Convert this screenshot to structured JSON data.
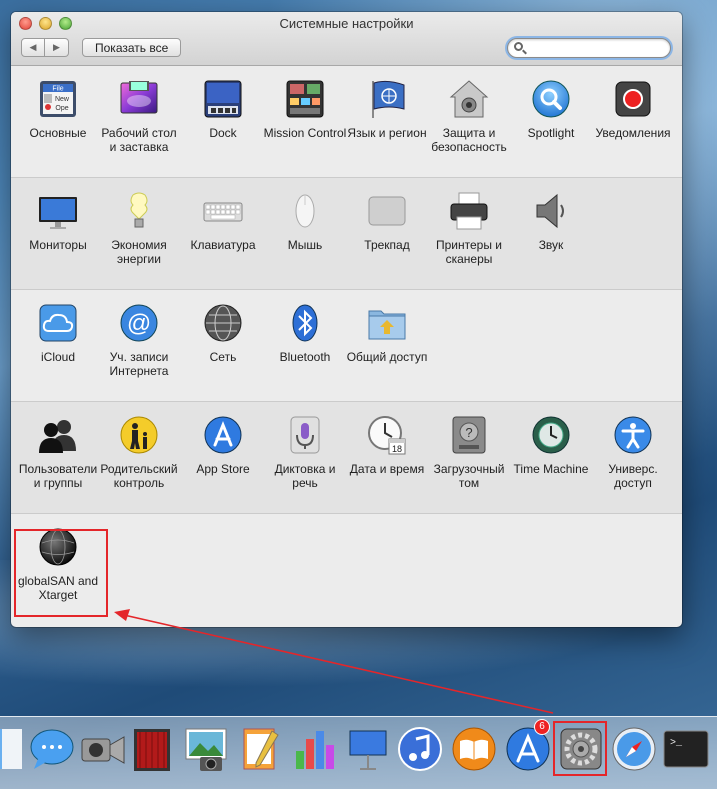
{
  "window": {
    "title": "Системные настройки",
    "show_all": "Показать все",
    "search_placeholder": ""
  },
  "rows": [
    [
      {
        "label": "Основные",
        "icon": "general-icon"
      },
      {
        "label": "Рабочий стол и заставка",
        "icon": "desktop-icon"
      },
      {
        "label": "Dock",
        "icon": "dock-icon"
      },
      {
        "label": "Mission Control",
        "icon": "mission-control-icon"
      },
      {
        "label": "Язык и регион",
        "icon": "language-icon"
      },
      {
        "label": "Защита и безопасность",
        "icon": "security-icon"
      },
      {
        "label": "Spotlight",
        "icon": "spotlight-icon"
      },
      {
        "label": "Уведомления",
        "icon": "notifications-icon"
      }
    ],
    [
      {
        "label": "Мониторы",
        "icon": "displays-icon"
      },
      {
        "label": "Экономия энергии",
        "icon": "energy-icon"
      },
      {
        "label": "Клавиатура",
        "icon": "keyboard-icon"
      },
      {
        "label": "Мышь",
        "icon": "mouse-icon"
      },
      {
        "label": "Трекпад",
        "icon": "trackpad-icon"
      },
      {
        "label": "Принтеры и сканеры",
        "icon": "printer-icon"
      },
      {
        "label": "Звук",
        "icon": "sound-icon"
      }
    ],
    [
      {
        "label": "iCloud",
        "icon": "icloud-icon"
      },
      {
        "label": "Уч. записи Интернета",
        "icon": "internet-accounts-icon"
      },
      {
        "label": "Сеть",
        "icon": "network-icon"
      },
      {
        "label": "Bluetooth",
        "icon": "bluetooth-icon"
      },
      {
        "label": "Общий доступ",
        "icon": "sharing-icon"
      }
    ],
    [
      {
        "label": "Пользователи и группы",
        "icon": "users-icon"
      },
      {
        "label": "Родительский контроль",
        "icon": "parental-icon"
      },
      {
        "label": "App Store",
        "icon": "appstore-icon"
      },
      {
        "label": "Диктовка и речь",
        "icon": "dictation-icon"
      },
      {
        "label": "Дата и время",
        "icon": "datetime-icon"
      },
      {
        "label": "Загрузочный том",
        "icon": "startup-disk-icon"
      },
      {
        "label": "Time Machine",
        "icon": "timemachine-icon"
      },
      {
        "label": "Универс. доступ",
        "icon": "accessibility-icon"
      }
    ],
    [
      {
        "label": "globalSAN and Xtarget",
        "icon": "globalsan-icon"
      }
    ]
  ],
  "icon_text": {
    "general_file": "File",
    "general_new": "New",
    "general_ope": "Ope",
    "calendar_day": "18"
  },
  "dock": {
    "icons": [
      "finder-icon",
      "messages-icon",
      "facetime-icon",
      "photobooth-icon",
      "iphoto-icon",
      "pages-icon",
      "numbers-icon",
      "keynote-icon",
      "itunes-icon",
      "ibooks-icon",
      "appstore-dock-icon",
      "system-preferences-icon",
      "safari-icon",
      "terminal-icon"
    ],
    "appstore_badge": "6",
    "terminal_prompt": ">_"
  },
  "colors": {
    "highlight": "#e4262a"
  }
}
